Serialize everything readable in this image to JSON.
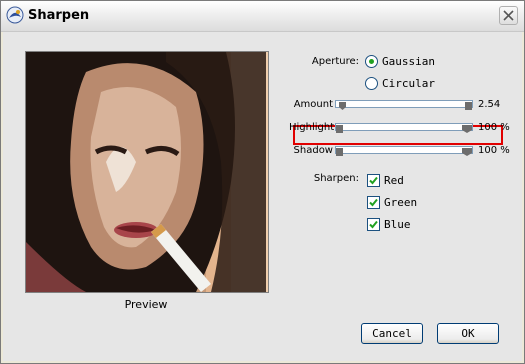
{
  "window": {
    "title": "Sharpen"
  },
  "preview": {
    "label": "Preview"
  },
  "aperture": {
    "label": "Aperture:",
    "options": [
      {
        "label": "Gaussian",
        "selected": true
      },
      {
        "label": "Circular",
        "selected": false
      }
    ]
  },
  "sliders": {
    "amount": {
      "label": "Amount",
      "value": "2.54",
      "level": 0.05
    },
    "highlight": {
      "label": "Highlight",
      "value": "100 %",
      "level": 1.0
    },
    "shadow": {
      "label": "Shadow",
      "value": "100 %",
      "level": 1.0
    }
  },
  "sharpen": {
    "label": "Sharpen:",
    "channels": [
      {
        "label": "Red",
        "checked": true
      },
      {
        "label": "Green",
        "checked": true
      },
      {
        "label": "Blue",
        "checked": true
      }
    ]
  },
  "buttons": {
    "cancel": "Cancel",
    "ok": "OK"
  },
  "colors": {
    "highlight_border": "#E10000",
    "radio_dot": "#21A121",
    "checkmark": "#21A121"
  }
}
